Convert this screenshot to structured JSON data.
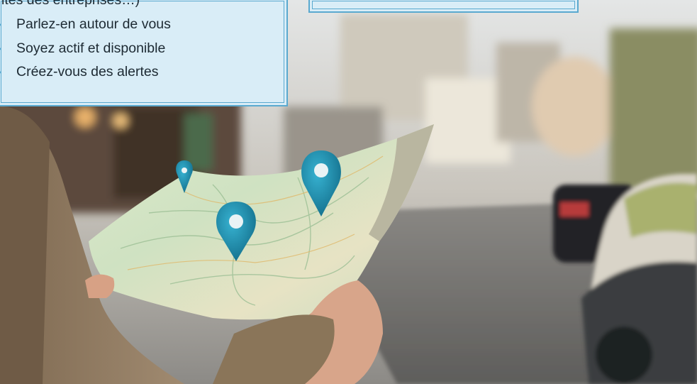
{
  "tips": {
    "cut_line": "ites des entreprises…)",
    "items": [
      "Parlez-en autour de vous",
      "Soyez actif et disponible",
      "Créez-vous des alertes"
    ]
  },
  "photo": {
    "subject": "map-with-location-pins",
    "pins": 3,
    "pin_color": "#1f8fb0"
  },
  "colors": {
    "box_fill": "#d9edf7",
    "box_border": "#5aa9cf",
    "text": "#1d2a33"
  }
}
